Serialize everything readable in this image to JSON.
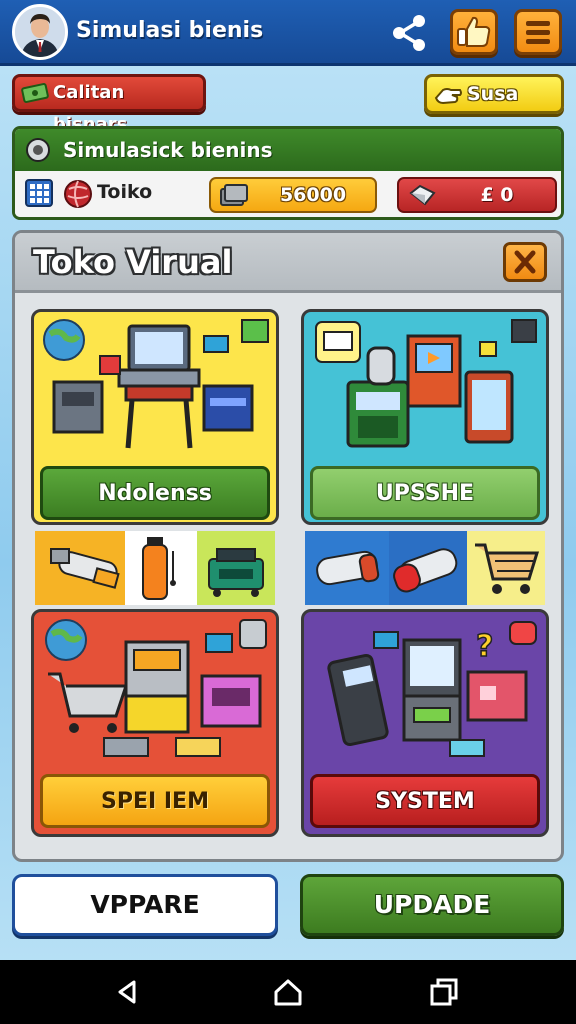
{
  "header": {
    "title": "Simulasi bienis",
    "icons": {
      "avatar": "avatar",
      "share": "share-icon",
      "like": "thumbs-up-icon",
      "menu": "hamburger-menu-icon"
    }
  },
  "actions": {
    "left_button": "Calitan bisnars",
    "right_button": "Susa"
  },
  "info_panel": {
    "title": "Simulasick bienins",
    "store_label": "Toiko",
    "gold_value": "56000",
    "red_value": "£ 0"
  },
  "main_panel": {
    "title": "Toko Virual",
    "cards": [
      {
        "label": "Ndolenss"
      },
      {
        "label": "UPSSHE"
      },
      {
        "label": "SPEI IEM"
      },
      {
        "label": "SYSTEM"
      }
    ]
  },
  "bottom": {
    "left_button": "VPPARE",
    "right_button": "UPDADE"
  },
  "colors": {
    "header_blue": "#1f5fb4",
    "accent_orange": "#f28c12",
    "green": "#3c7e22",
    "red": "#b82a1f",
    "yellow": "#f2cc13",
    "purple": "#6a45a8"
  }
}
